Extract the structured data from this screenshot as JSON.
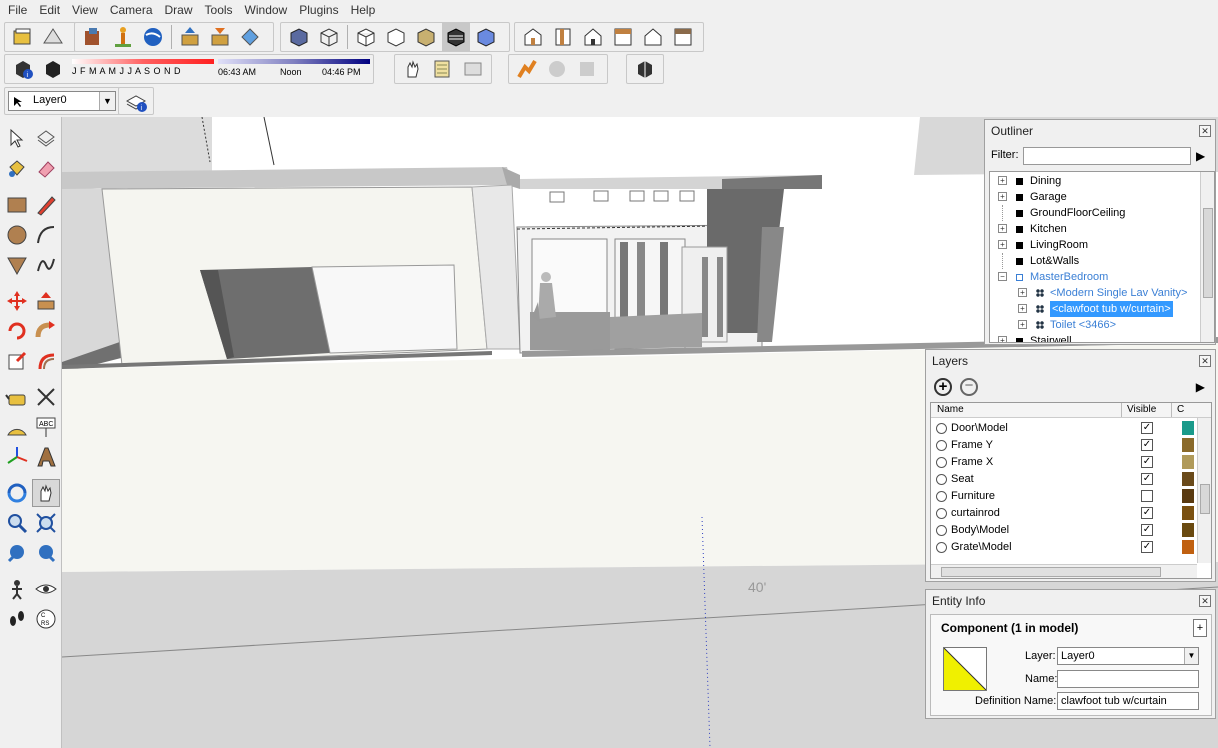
{
  "menu": [
    "File",
    "Edit",
    "View",
    "Camera",
    "Draw",
    "Tools",
    "Window",
    "Plugins",
    "Help"
  ],
  "shadow": {
    "months": "J F M A M J J A S O N D",
    "time_start": "06:43 AM",
    "time_mid": "Noon",
    "time_end": "04:46 PM"
  },
  "layer_select": "Layer0",
  "viewport": {
    "dimension_label": "40'"
  },
  "outliner": {
    "title": "Outliner",
    "filter_label": "Filter:",
    "items": [
      {
        "label": "Dining",
        "expand": "+",
        "level": 0
      },
      {
        "label": "Garage",
        "expand": "+",
        "level": 0
      },
      {
        "label": "GroundFloorCeiling",
        "expand": "",
        "level": 0
      },
      {
        "label": "Kitchen",
        "expand": "+",
        "level": 0
      },
      {
        "label": "LivingRoom",
        "expand": "+",
        "level": 0
      },
      {
        "label": "Lot&Walls",
        "expand": "",
        "level": 0
      },
      {
        "label": "MasterBedroom",
        "expand": "-",
        "level": 0,
        "style": "group"
      },
      {
        "label": "<Modern Single Lav Vanity>",
        "expand": "+",
        "level": 1,
        "style": "component"
      },
      {
        "label": "<clawfoot tub w/curtain>",
        "expand": "+",
        "level": 1,
        "style": "selected"
      },
      {
        "label": "Toilet <3466>",
        "expand": "+",
        "level": 1,
        "style": "component"
      },
      {
        "label": "Stairwell",
        "expand": "+",
        "level": 0
      }
    ]
  },
  "layers": {
    "title": "Layers",
    "col_name": "Name",
    "col_visible": "Visible",
    "col_color": "C",
    "rows": [
      {
        "name": "Door\\Model",
        "visible": true,
        "color": "#1a9a8a"
      },
      {
        "name": "Frame Y",
        "visible": true,
        "color": "#8a6a2a"
      },
      {
        "name": "Frame X",
        "visible": true,
        "color": "#b09a5a"
      },
      {
        "name": "Seat",
        "visible": true,
        "color": "#6a4a1a"
      },
      {
        "name": "Furniture",
        "visible": false,
        "color": "#5a3a10"
      },
      {
        "name": "curtainrod",
        "visible": true,
        "color": "#7a5010"
      },
      {
        "name": "Body\\Model",
        "visible": true,
        "color": "#6a4a10"
      },
      {
        "name": "Grate\\Model",
        "visible": true,
        "color": "#c06010"
      }
    ]
  },
  "entity": {
    "title": "Entity Info",
    "heading": "Component (1 in model)",
    "layer_label": "Layer:",
    "layer_value": "Layer0",
    "name_label": "Name:",
    "name_value": "",
    "def_label": "Definition Name:",
    "def_value": "clawfoot tub w/curtain"
  },
  "colors": {
    "selected": "#3399ff",
    "component_text": "#3a7fd5"
  }
}
